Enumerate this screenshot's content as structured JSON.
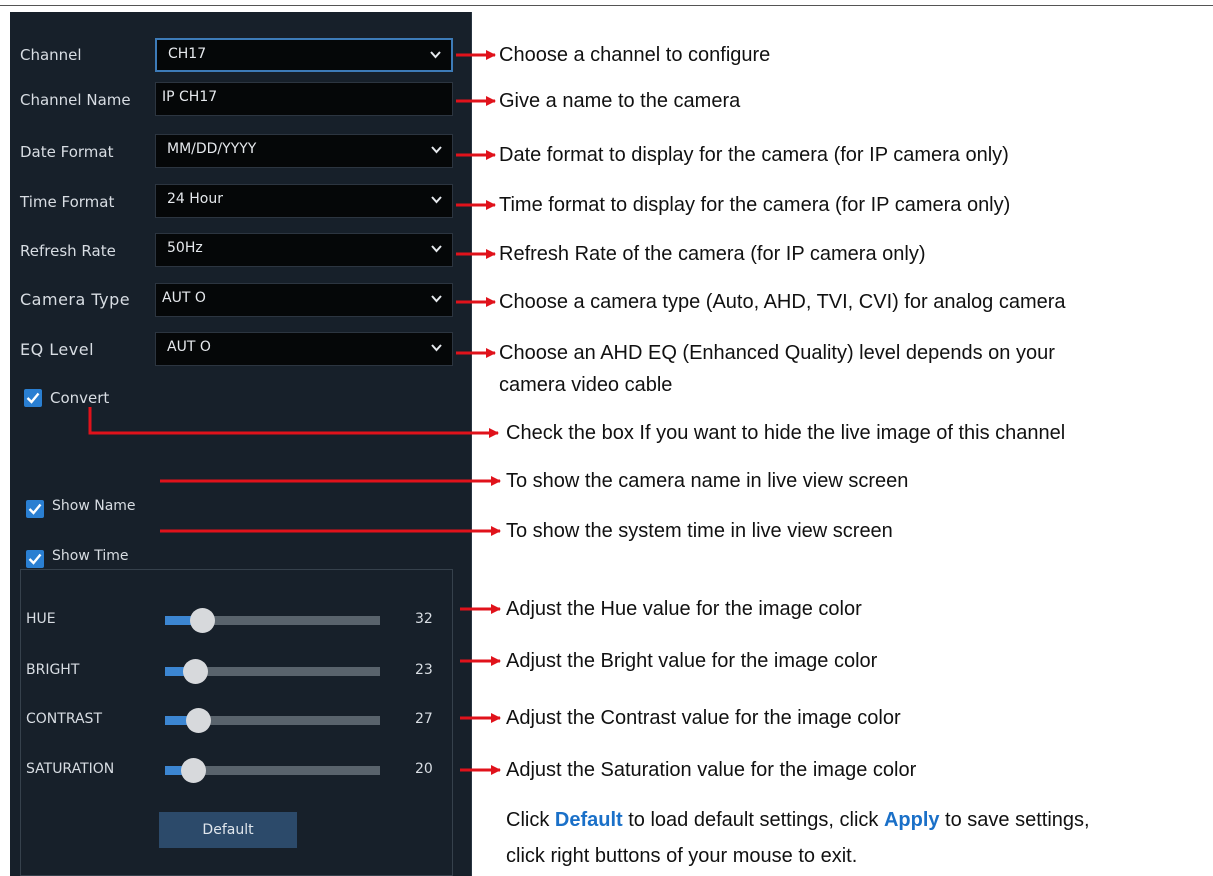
{
  "panel": {
    "rows": [
      {
        "label": "Channel",
        "value": "CH17",
        "type": "select"
      },
      {
        "label": "Channel Name",
        "value": "IP CH17",
        "type": "input"
      },
      {
        "label": "Date Format",
        "value": "MM/DD/YYYY",
        "type": "select"
      },
      {
        "label": "Time Format",
        "value": "24 Hour",
        "type": "select"
      },
      {
        "label": "Refresh Rate",
        "value": "50Hz",
        "type": "select"
      },
      {
        "label": "Camera Type",
        "value": "AUT O",
        "type": "select"
      },
      {
        "label": "EQ Level",
        "value": "AUT O",
        "type": "select"
      }
    ],
    "checkboxes": [
      {
        "label": "Convert",
        "checked": true
      },
      {
        "label": "Show Name",
        "checked": true
      },
      {
        "label": "Show Time",
        "checked": true
      }
    ],
    "sliders": [
      {
        "label": "HUE",
        "value": "32",
        "level": 0.32
      },
      {
        "label": "BRIGHT",
        "value": "23",
        "level": 0.23
      },
      {
        "label": "CONTRAST",
        "value": "27",
        "level": 0.27
      },
      {
        "label": "SATURATION",
        "value": "20",
        "level": 0.2
      }
    ],
    "default_button": "Default"
  },
  "annotations": [
    "Choose a channel to configure",
    "Give a name to the camera",
    "Date format to display for the camera (for IP camera only)",
    "Time format to display for the camera (for IP camera only)",
    "Refresh Rate of the camera (for IP camera only)",
    "Choose a camera type (Auto, AHD, TVI, CVI) for analog camera",
    "Choose an AHD EQ (Enhanced Quality) level depends on your",
    "camera video cable",
    "Check the box If you want to hide the live image of this channel",
    "To show the camera name in live view screen",
    "To show the system time in live view screen",
    "Adjust the Hue value for the image color",
    "Adjust the Bright value for the image color",
    "Adjust the Contrast value for the image color",
    "Adjust the Saturation value for the image color"
  ],
  "footer_note": {
    "part1": "Click ",
    "default_word": "Default",
    "part2": " to load default settings, click ",
    "apply_word": "Apply",
    "part3": " to save settings,",
    "line2": "click right buttons of your mouse to exit."
  },
  "colors": {
    "panel_bg": "#17202a",
    "accent": "#2a7fd2",
    "arrow": "#e0121b",
    "keyword": "#1a70c8"
  }
}
